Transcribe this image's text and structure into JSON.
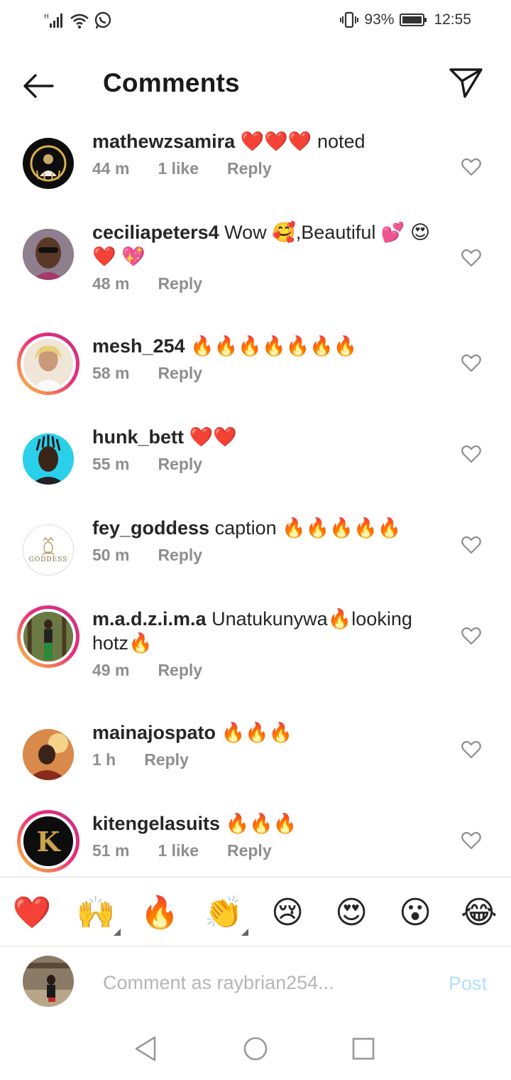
{
  "status_bar": {
    "battery_percent": "93%",
    "time": "12:55",
    "icons": [
      "signal-icon",
      "wifi-icon",
      "whatsapp-icon",
      "vibrate-icon",
      "battery-icon"
    ]
  },
  "header": {
    "title": "Comments",
    "back_icon": "arrow-left-icon",
    "share_icon": "paper-plane-icon"
  },
  "comments": [
    {
      "username": "mathewzsamira",
      "text": "❤️❤️❤️ noted",
      "time": "44 m",
      "likes": "1 like",
      "reply": "Reply"
    },
    {
      "username": "ceciliapeters4",
      "text": "Wow 🥰,Beautiful 💕 😍 ❤️ 💖",
      "time": "48 m",
      "likes": "",
      "reply": "Reply"
    },
    {
      "username": "mesh_254",
      "text": "🔥🔥🔥🔥🔥🔥🔥",
      "time": "58 m",
      "likes": "",
      "reply": "Reply"
    },
    {
      "username": "hunk_bett",
      "text": "❤️❤️",
      "time": "55 m",
      "likes": "",
      "reply": "Reply"
    },
    {
      "username": "fey_goddess",
      "text": "caption 🔥🔥🔥🔥🔥",
      "time": "50 m",
      "likes": "",
      "reply": "Reply"
    },
    {
      "username": "m.a.d.z.i.m.a",
      "text": "Unatukunywa🔥looking hotz🔥",
      "time": "49 m",
      "likes": "",
      "reply": "Reply"
    },
    {
      "username": "mainajospato",
      "text": "🔥🔥🔥",
      "time": "1 h",
      "likes": "",
      "reply": "Reply"
    },
    {
      "username": "kitengelasuits",
      "text": "🔥🔥🔥",
      "time": "51 m",
      "likes": "1 like",
      "reply": "Reply"
    }
  ],
  "avatar_text": {
    "goddess": "GODDESS",
    "kitengela": "K"
  },
  "quick_emojis": [
    "❤️",
    "🙌",
    "🔥",
    "👏",
    "😢",
    "😍",
    "😮",
    "😂"
  ],
  "composer": {
    "placeholder": "Comment as raybrian254...",
    "post_label": "Post"
  },
  "colors": {
    "text": "#262626",
    "meta": "#8e8e8e",
    "post_disabled": "#b2dffc",
    "story_ring_start": "#f9ce34",
    "story_ring_end": "#c13584"
  }
}
